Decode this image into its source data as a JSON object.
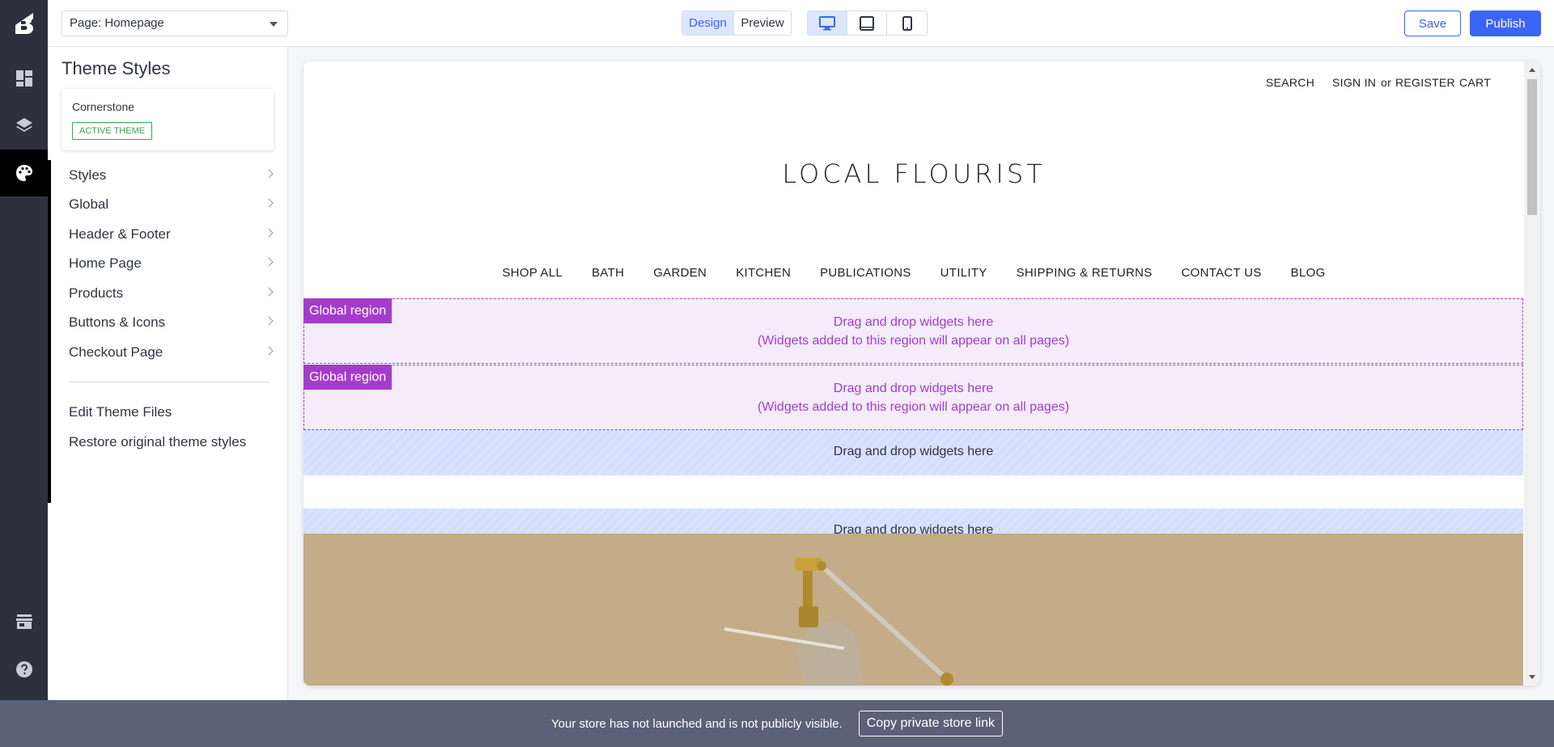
{
  "rail": {
    "items": [
      {
        "icon": "dashboard-icon"
      },
      {
        "icon": "layers-icon"
      },
      {
        "icon": "palette-icon"
      },
      {
        "icon": "storefront-icon"
      },
      {
        "icon": "help-icon"
      }
    ]
  },
  "topbar": {
    "page_select": "Page: Homepage",
    "mode_design": "Design",
    "mode_preview": "Preview",
    "save_label": "Save",
    "publish_label": "Publish"
  },
  "panel": {
    "title": "Theme Styles",
    "theme_name": "Cornerstone",
    "theme_badge": "ACTIVE THEME",
    "menu": [
      {
        "label": "Styles"
      },
      {
        "label": "Global"
      },
      {
        "label": "Header & Footer"
      },
      {
        "label": "Home Page"
      },
      {
        "label": "Products"
      },
      {
        "label": "Buttons & Icons"
      },
      {
        "label": "Checkout Page"
      }
    ],
    "links": [
      {
        "label": "Edit Theme Files"
      },
      {
        "label": "Restore original theme styles"
      }
    ]
  },
  "store": {
    "search": "SEARCH",
    "sign_in": "SIGN IN",
    "or": "or",
    "register": "REGISTER",
    "cart": "CART",
    "logo": "LOCAL FLOURIST",
    "nav": [
      "SHOP ALL",
      "BATH",
      "GARDEN",
      "KITCHEN",
      "PUBLICATIONS",
      "UTILITY",
      "SHIPPING & RETURNS",
      "CONTACT US",
      "BLOG"
    ]
  },
  "regions": {
    "global_tag": "Global region",
    "global_line1": "Drag and drop widgets here",
    "global_line2": "(Widgets added to this region will appear on all pages)",
    "local_text": "Drag and drop widgets here"
  },
  "notice": {
    "message": "Your store has not launched and is not publicly visible.",
    "copy_label": "Copy private store link"
  },
  "colors": {
    "accent": "#3c64f4",
    "rail": "#2e303e",
    "global_region": "#a43ccb",
    "active_badge": "#2eaa4a"
  }
}
